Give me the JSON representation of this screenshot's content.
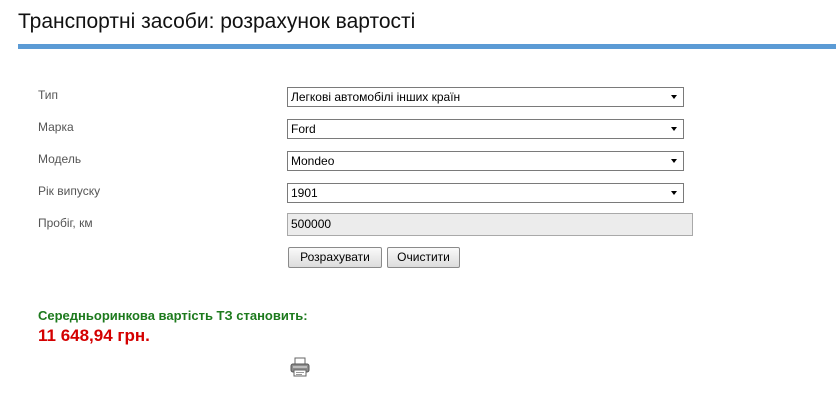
{
  "page": {
    "title": "Транспортні засоби: розрахунок вартості",
    "accent_color": "#5b9bd5"
  },
  "form": {
    "type": {
      "label": "Тип",
      "value": "Легкові автомобілі інших країн"
    },
    "make": {
      "label": "Марка",
      "value": "Ford"
    },
    "model": {
      "label": "Модель",
      "value": "Mondeo"
    },
    "year": {
      "label": "Рік випуску",
      "value": "1901"
    },
    "mileage": {
      "label": "Пробіг, км",
      "value": "500000"
    },
    "calculate_label": "Розрахувати",
    "clear_label": "Очистити"
  },
  "result": {
    "label": "Середньоринкова вартість ТЗ становить:",
    "value": "11 648,94 грн.",
    "label_color": "#1d7a1d",
    "value_color": "#d40000"
  },
  "icons": {
    "print": "printer-icon"
  }
}
